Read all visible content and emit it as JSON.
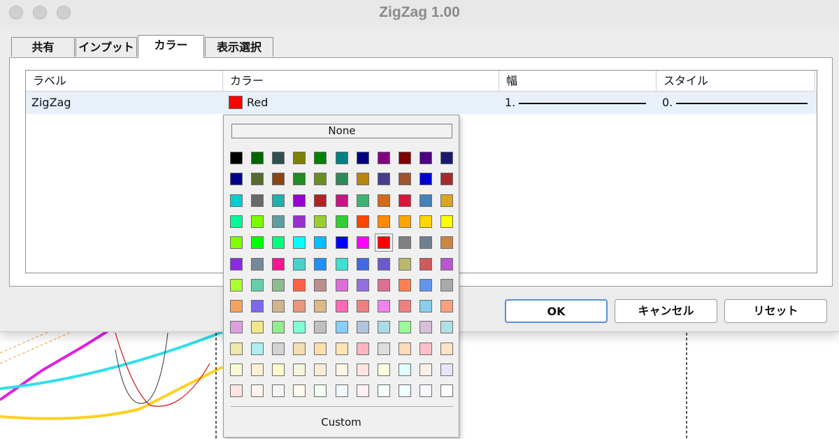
{
  "window": {
    "title": "ZigZag 1.00"
  },
  "tabs": [
    {
      "label": "共有"
    },
    {
      "label": "インプット"
    },
    {
      "label": "カラー"
    },
    {
      "label": "表示選択"
    }
  ],
  "active_tab": "カラー",
  "table": {
    "headers": [
      "ラベル",
      "カラー",
      "幅",
      "スタイル"
    ],
    "rows": [
      {
        "label": "ZigZag",
        "color_name": "Red",
        "color_hex": "#ff0000",
        "width": "1.",
        "style": "0."
      }
    ]
  },
  "buttons": {
    "ok": "OK",
    "cancel": "キャンセル",
    "reset": "リセット"
  },
  "color_popup": {
    "none_label": "None",
    "custom_label": "Custom",
    "selected": "#ff0000",
    "palette": [
      [
        "#000000",
        "#006400",
        "#2f4f4f",
        "#808000",
        "#008000",
        "#008080",
        "#000080",
        "#800080",
        "#800000",
        "#4b0082",
        "#191970"
      ],
      [
        "#00008b",
        "#556b2f",
        "#8b4513",
        "#228b22",
        "#6b8e23",
        "#2e8b57",
        "#b8860b",
        "#483d8b",
        "#a0522d",
        "#0000cd",
        "#a52a2a"
      ],
      [
        "#00ced1",
        "#696969",
        "#20b2aa",
        "#9400d3",
        "#b22222",
        "#c71585",
        "#3cb371",
        "#d2691e",
        "#dc143c",
        "#4682b4",
        "#daa520"
      ],
      [
        "#00fa9a",
        "#7cfc00",
        "#5f9ea0",
        "#9932cc",
        "#9acd32",
        "#32cd32",
        "#ff4500",
        "#ff8c00",
        "#ffa500",
        "#ffd700",
        "#ffff00"
      ],
      [
        "#7fff00",
        "#00ff00",
        "#00ff7f",
        "#00ffff",
        "#00bfff",
        "#0000ff",
        "#ff00ff",
        "#ff0000",
        "#808080",
        "#708090",
        "#cd853f"
      ],
      [
        "#8a2be2",
        "#778899",
        "#ff1493",
        "#48d1cc",
        "#1e90ff",
        "#40e0d0",
        "#4169e1",
        "#6a5acd",
        "#bdb76b",
        "#cd5c5c",
        "#ba55d3"
      ],
      [
        "#adff2f",
        "#66cdaa",
        "#8fbc8f",
        "#ff6347",
        "#bc8f8f",
        "#da70d6",
        "#9370db",
        "#db7093",
        "#ff7f50",
        "#6495ed",
        "#a9a9a9"
      ],
      [
        "#f4a460",
        "#7b68ee",
        "#d2b48c",
        "#e9967a",
        "#deb887",
        "#ff69b4",
        "#f08080",
        "#ee82ee",
        "#f08080",
        "#87ceeb",
        "#ffa07a"
      ],
      [
        "#dda0dd",
        "#f0e68c",
        "#90ee90",
        "#7fffd4",
        "#c0c0c0",
        "#87cefa",
        "#b0c4de",
        "#add8e6",
        "#98fb98",
        "#d8bfd8",
        "#b0e0e6"
      ],
      [
        "#eee8aa",
        "#afeeee",
        "#d3d3d3",
        "#f5deb3",
        "#ffdead",
        "#ffe4b5",
        "#ffb6c1",
        "#dcdcdc",
        "#ffdab9",
        "#ffc0cb",
        "#ffe4c4"
      ],
      [
        "#fafad2",
        "#ffefd5",
        "#fffacd",
        "#f5f5dc",
        "#faebd7",
        "#fdf5e6",
        "#ffe4e1",
        "#ffffe0",
        "#e0ffff",
        "#faf0e6",
        "#e6e6fa"
      ],
      [
        "#ffe4e1",
        "#fff5ee",
        "#f5f5f5",
        "#fffaf0",
        "#f0fff0",
        "#f0f8ff",
        "#fff0f5",
        "#f5fffa",
        "#f0ffff",
        "#f8f8ff",
        "#ffffff"
      ]
    ]
  }
}
